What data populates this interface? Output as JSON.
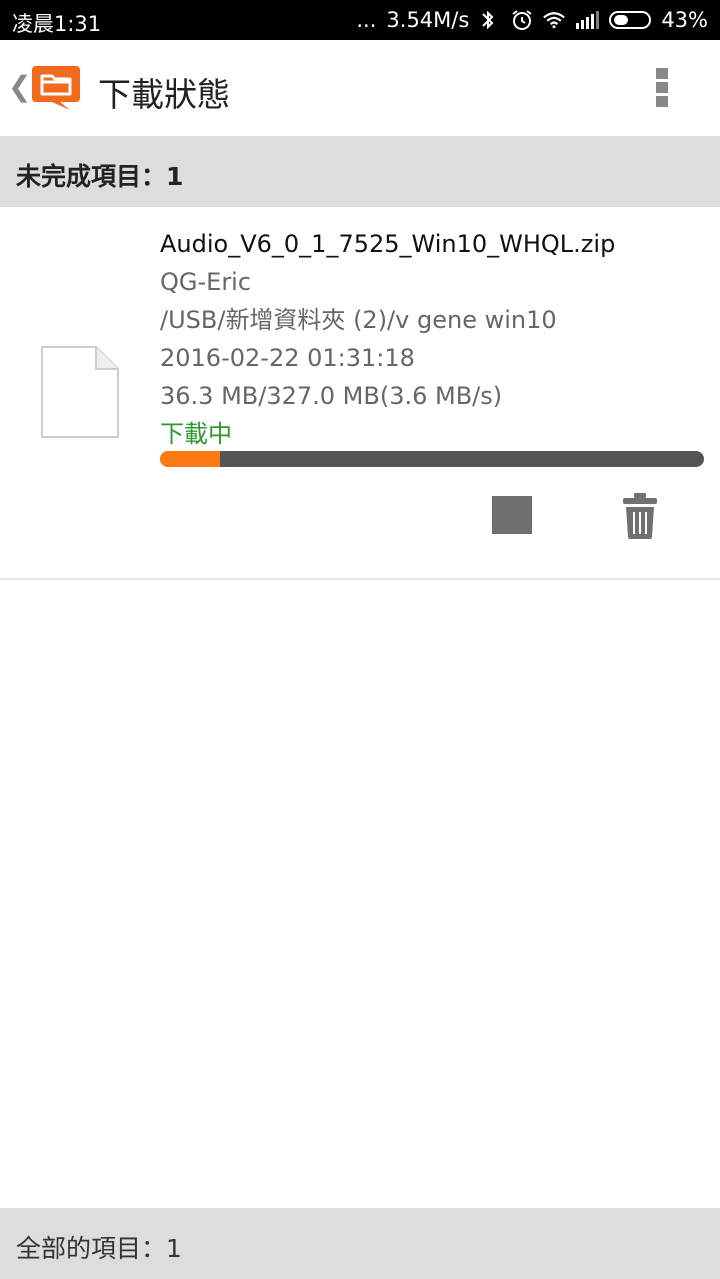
{
  "status_bar": {
    "time": "凌晨1:31",
    "dots": "...",
    "net_speed": "3.54M/s",
    "battery": "43%"
  },
  "app_bar": {
    "title": "下載狀態",
    "back_glyph": "❮"
  },
  "section": {
    "incomplete_label": "未完成項目：1"
  },
  "download_item": {
    "filename": "Audio_V6_0_1_7525_Win10_WHQL.zip",
    "source": "QG-Eric",
    "path": "/USB/新增資料夾 (2)/v gene win10",
    "datetime": "2016-02-22 01:31:18",
    "size_progress": "36.3 MB/327.0 MB(3.6 MB/s)",
    "status": "下載中",
    "progress_fraction": 0.111
  },
  "footer": {
    "all_items_label": "全部的項目：1"
  },
  "colors": {
    "accent_orange": "#ff7a12",
    "status_green": "#2b9a2b",
    "section_bg": "#dddddd"
  },
  "icons": {
    "back": "chevron-left-icon",
    "logo": "folder-chat-logo-icon",
    "menu": "more-vertical-icon",
    "file": "file-icon",
    "stop": "stop-icon",
    "delete": "trash-icon"
  }
}
